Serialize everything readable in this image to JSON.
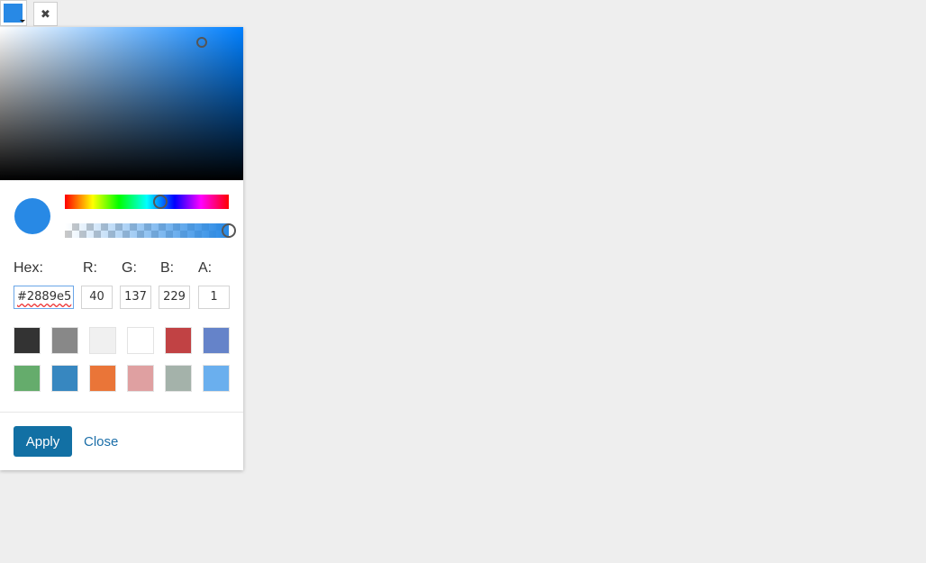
{
  "trigger": {
    "color": "#2889e5",
    "caret_icon": "caret-down-icon"
  },
  "clear_button": {
    "icon": "close-icon",
    "glyph": "✖"
  },
  "picker": {
    "hue_color": "#0080ff",
    "current_color": "#2889e5",
    "sv": {
      "saturation": 0.83,
      "value": 0.9
    },
    "hue": {
      "degrees": 209,
      "fraction": 0.58
    },
    "alpha": {
      "value": 1
    },
    "labels": {
      "hex": "Hex:",
      "r": "R:",
      "g": "G:",
      "b": "B:",
      "a": "A:"
    },
    "values": {
      "hex": "#2889e5",
      "r": "40",
      "g": "137",
      "b": "229",
      "a": "1"
    },
    "swatches": [
      "#333333",
      "#888888",
      "#f0f0f0",
      "#ffffff",
      "#c14244",
      "#6583c9",
      "#65ac6c",
      "#3787c0",
      "#ea7538",
      "#dfa0a1",
      "#a4b2aa",
      "#6aafee"
    ],
    "apply_label": "Apply",
    "close_label": "Close"
  }
}
